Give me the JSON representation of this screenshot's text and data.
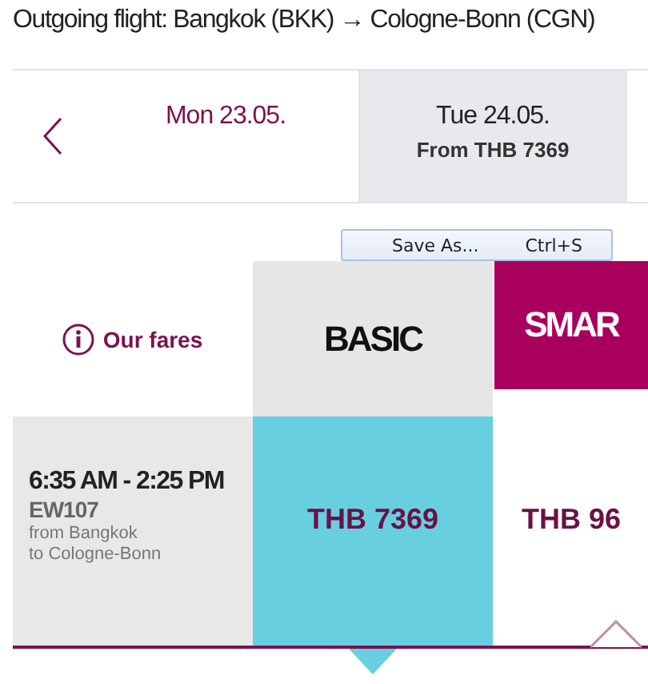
{
  "title": "Outgoing flight: Bangkok (BKK) → Cologne-Bonn (CGN)",
  "dates": [
    {
      "day": "Mon 23.05.",
      "selected": false
    },
    {
      "day": "Tue 24.05.",
      "price": "From THB 7369",
      "selected": true
    }
  ],
  "context_menu": {
    "items": [
      {
        "label": "Save As...",
        "shortcut": "Ctrl+S"
      }
    ]
  },
  "fares_link": "Our fares",
  "fares": [
    {
      "name": "BASIC",
      "color": "#e6e6e6"
    },
    {
      "name": "SMAR",
      "color": "#a8005c"
    }
  ],
  "flight": {
    "times": "6:35 AM - 2:25 PM",
    "number": "EW107",
    "from": "from Bangkok",
    "to": "to Cologne-Bonn",
    "prices": [
      {
        "price": "THB 7369",
        "selected": true
      },
      {
        "price": "THB 96",
        "selected": false
      }
    ]
  }
}
